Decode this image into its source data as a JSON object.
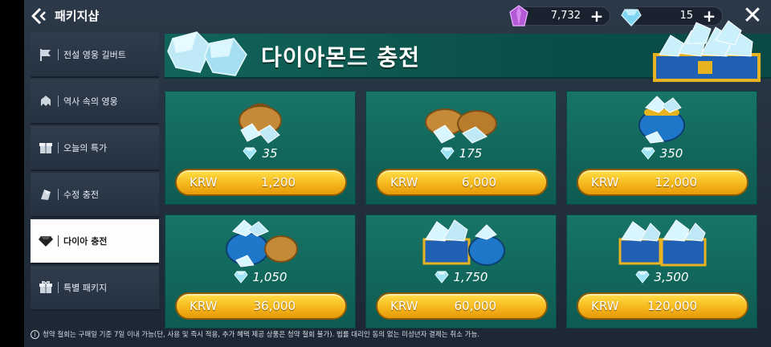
{
  "header": {
    "title": "패키지샵",
    "currencies": [
      {
        "name": "crystal",
        "value": "7,732",
        "color": "#c46de0"
      },
      {
        "name": "diamond",
        "value": "15",
        "color": "#7fd6f2"
      }
    ],
    "plus_glyph": "+",
    "close_glyph": "✕"
  },
  "sidebar": {
    "items": [
      {
        "label": "전설 영웅 길버트",
        "icon": "flag-icon",
        "active": false
      },
      {
        "label": "역사 속의 영웅",
        "icon": "helmet-icon",
        "active": false
      },
      {
        "label": "오늘의 특가",
        "icon": "box-icon",
        "active": false
      },
      {
        "label": "수정 충전",
        "icon": "crystal-icon",
        "active": false
      },
      {
        "label": "다이아 충전",
        "icon": "diamond-icon",
        "active": true
      },
      {
        "label": "특별 패키지",
        "icon": "gift-icon",
        "active": false
      }
    ]
  },
  "banner": {
    "title": "다이아몬드 충전"
  },
  "packages": [
    {
      "amount": "35",
      "currency": "KRW",
      "price": "1,200",
      "art": "small-bag"
    },
    {
      "amount": "175",
      "currency": "KRW",
      "price": "6,000",
      "art": "two-bags"
    },
    {
      "amount": "350",
      "currency": "KRW",
      "price": "12,000",
      "art": "blue-pot"
    },
    {
      "amount": "1,050",
      "currency": "KRW",
      "price": "36,000",
      "art": "pot-and-bag"
    },
    {
      "amount": "1,750",
      "currency": "KRW",
      "price": "60,000",
      "art": "chest-and-pot"
    },
    {
      "amount": "3,500",
      "currency": "KRW",
      "price": "120,000",
      "art": "two-chests"
    }
  ],
  "footer": {
    "info_glyph": "i",
    "note": "청약 철회는 구매일 기준 7일 이내 가능(단, 사용 및 즉시 적용, 추가 혜택 제공 상품은 청약 철회 불가). 법률 대리인 동의 없는 미성년자 결제는 취소 가능."
  }
}
